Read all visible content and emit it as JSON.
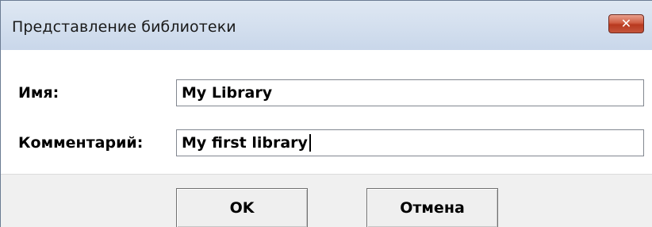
{
  "window": {
    "title": "Представление библиотеки",
    "close_symbol": "✕"
  },
  "form": {
    "name_label": "Имя:",
    "name_value": "My Library",
    "comment_label": "Комментарий:",
    "comment_value": "My first library"
  },
  "buttons": {
    "ok_label": "OK",
    "cancel_label": "Отмена"
  },
  "colors": {
    "titlebar": "#c9d7ea",
    "close_button": "#cf5d43"
  }
}
